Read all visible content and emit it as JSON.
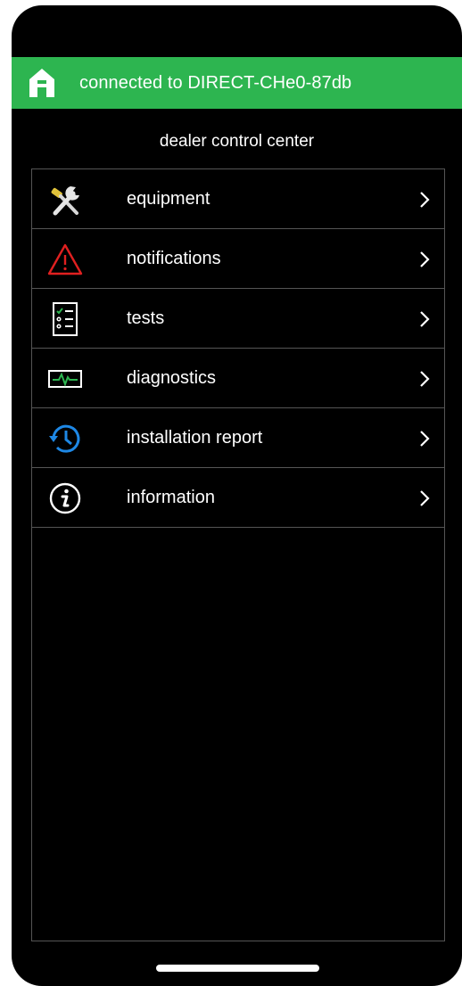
{
  "status": {
    "text": "connected to DIRECT-CHe0-87db",
    "icon": "home-icon",
    "color": "#2db550"
  },
  "title": "dealer control center",
  "menu": [
    {
      "label": "equipment",
      "icon": "tools-icon"
    },
    {
      "label": "notifications",
      "icon": "warning-icon"
    },
    {
      "label": "tests",
      "icon": "checklist-icon"
    },
    {
      "label": "diagnostics",
      "icon": "heartbeat-monitor-icon"
    },
    {
      "label": "installation report",
      "icon": "history-clock-icon"
    },
    {
      "label": "information",
      "icon": "info-icon"
    }
  ]
}
